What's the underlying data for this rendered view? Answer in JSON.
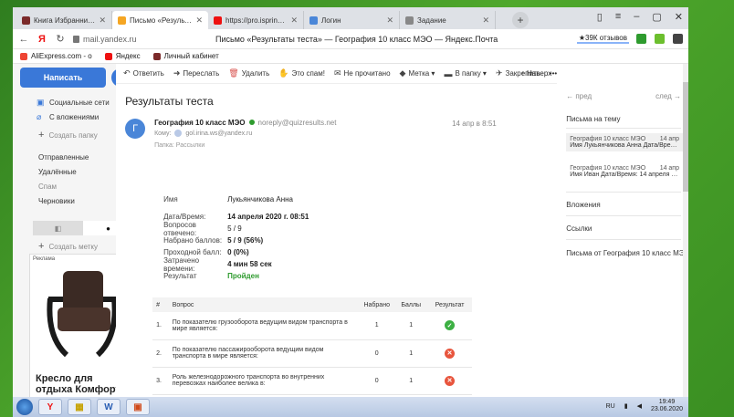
{
  "tabs": [
    {
      "title": "Книга Избранница Хозяи",
      "fav": "#7b2a2a",
      "active": false
    },
    {
      "title": "Письмо «Результаты те",
      "fav": "#f5a623",
      "active": true
    },
    {
      "title": "https://pro.ispringcloud.ru",
      "fav": "#e11",
      "active": false
    },
    {
      "title": "Логин",
      "fav": "#4a86d8",
      "active": false
    },
    {
      "title": "Задание",
      "fav": "#888",
      "active": false
    }
  ],
  "browser": {
    "url": "mail.yandex.ru",
    "page_title": "Письмо «Результаты теста» — География 10 класс МЭО — Яндекс.Почта",
    "reviews": "★39К отзывов",
    "newtab": "+",
    "win_controls": [
      "▯",
      "≡",
      "–",
      "▢",
      "✕"
    ],
    "nav": [
      "←",
      "Я",
      "↻"
    ]
  },
  "bookmarks": [
    {
      "label": "AliExpress.com - о",
      "color": "#e43"
    },
    {
      "label": "Яндекс",
      "color": "#e11"
    },
    {
      "label": "Личный кабинет",
      "color": "#7b2a2a"
    }
  ],
  "sidebar": {
    "compose": "Написать",
    "refresh": "⟳",
    "items_top": [
      {
        "icon": "▣",
        "label": "Социальные сети"
      },
      {
        "icon": "⌀",
        "label": "С вложениями"
      }
    ],
    "create_folder": "Создать папку",
    "folders": [
      "Отправленные",
      "Удалённые",
      "Спам",
      "Черновики"
    ],
    "toggle": [
      "◧",
      "●"
    ],
    "create_label": "Создать метку",
    "ad_label": "Реклама",
    "ad_title": "Кресло для отдыха Комфорт"
  },
  "toolbar": {
    "items": [
      {
        "icon": "↶",
        "label": "Ответить"
      },
      {
        "icon": "➜",
        "label": "Переслать"
      },
      {
        "icon": "🗑",
        "label": "Удалить"
      },
      {
        "icon": "✋",
        "label": "Это спам!"
      },
      {
        "icon": "✉",
        "label": "Не прочитано"
      },
      {
        "icon": "◆",
        "label": "Метка ▾"
      },
      {
        "icon": "▬",
        "label": "В папку ▾"
      },
      {
        "icon": "✈",
        "label": "Закрепить"
      },
      {
        "icon": "",
        "label": "•••"
      }
    ],
    "up": "↑ Наверх"
  },
  "message": {
    "subject": "Результаты теста",
    "avatar": "Г",
    "from_name": "География 10 класс МЭО",
    "from_addr": "noreply@quizresults.net",
    "to_label": "Кому:",
    "to_addr": "gol.irina.ws@yandex.ru",
    "folder": "Папка: Рассылки",
    "date": "14 апр в 8:51"
  },
  "results": [
    {
      "k": "Имя",
      "v": "Лукьянчикова Анна",
      "style": ""
    },
    {
      "k": "Дата/Время:",
      "v": "14 апреля 2020 г. 08:51",
      "style": "bold"
    },
    {
      "k": "Вопросов отвечено:",
      "v": "5 / 9",
      "style": ""
    },
    {
      "k": "Набрано баллов:",
      "v": "5 / 9 (56%)",
      "style": "bold"
    },
    {
      "k": "Проходной балл:",
      "v": "0 (0%)",
      "style": "bold"
    },
    {
      "k": "Затрачено времени:",
      "v": "4 мин 58 сек",
      "style": "bold"
    },
    {
      "k": "Результат",
      "v": "Пройден",
      "style": "green"
    }
  ],
  "table": {
    "headers": [
      "#",
      "Вопрос",
      "Набрано",
      "Баллы",
      "Результат"
    ],
    "rows": [
      {
        "n": "1.",
        "q": "По показателю грузооборота ведущим видом транспорта в мире является:",
        "got": "1",
        "pts": "1",
        "ok": true
      },
      {
        "n": "2.",
        "q": "По показателю пассажирооборота ведущим видом транспорта в мире является:",
        "got": "0",
        "pts": "1",
        "ok": false
      },
      {
        "n": "3.",
        "q": "Роль железнодорожного транспорта во внутренних перевозках наиболее велика в:",
        "got": "0",
        "pts": "1",
        "ok": false
      }
    ]
  },
  "right": {
    "prev": "← пред",
    "next": "след →",
    "thread_h": "Письма на тему",
    "thread": [
      {
        "from": "География 10 класс МЭО",
        "date": "14 апр",
        "sub": "Имя Лукьянчикова Анна Дата/Время...",
        "sel": true
      },
      {
        "from": "География 10 класс МЭО",
        "date": "14 апр",
        "sub": "Имя Иван Дата/Время: 14 апреля 2...",
        "sel": false
      }
    ],
    "attachments": "Вложения",
    "links": "Ссылки",
    "from_h": "Письма от География 10 класс МЭО"
  },
  "taskbar": {
    "apps": [
      "Y",
      "▦",
      "W",
      "▣"
    ],
    "lang": "RU",
    "time": "19:49",
    "date": "23.06.2020"
  }
}
